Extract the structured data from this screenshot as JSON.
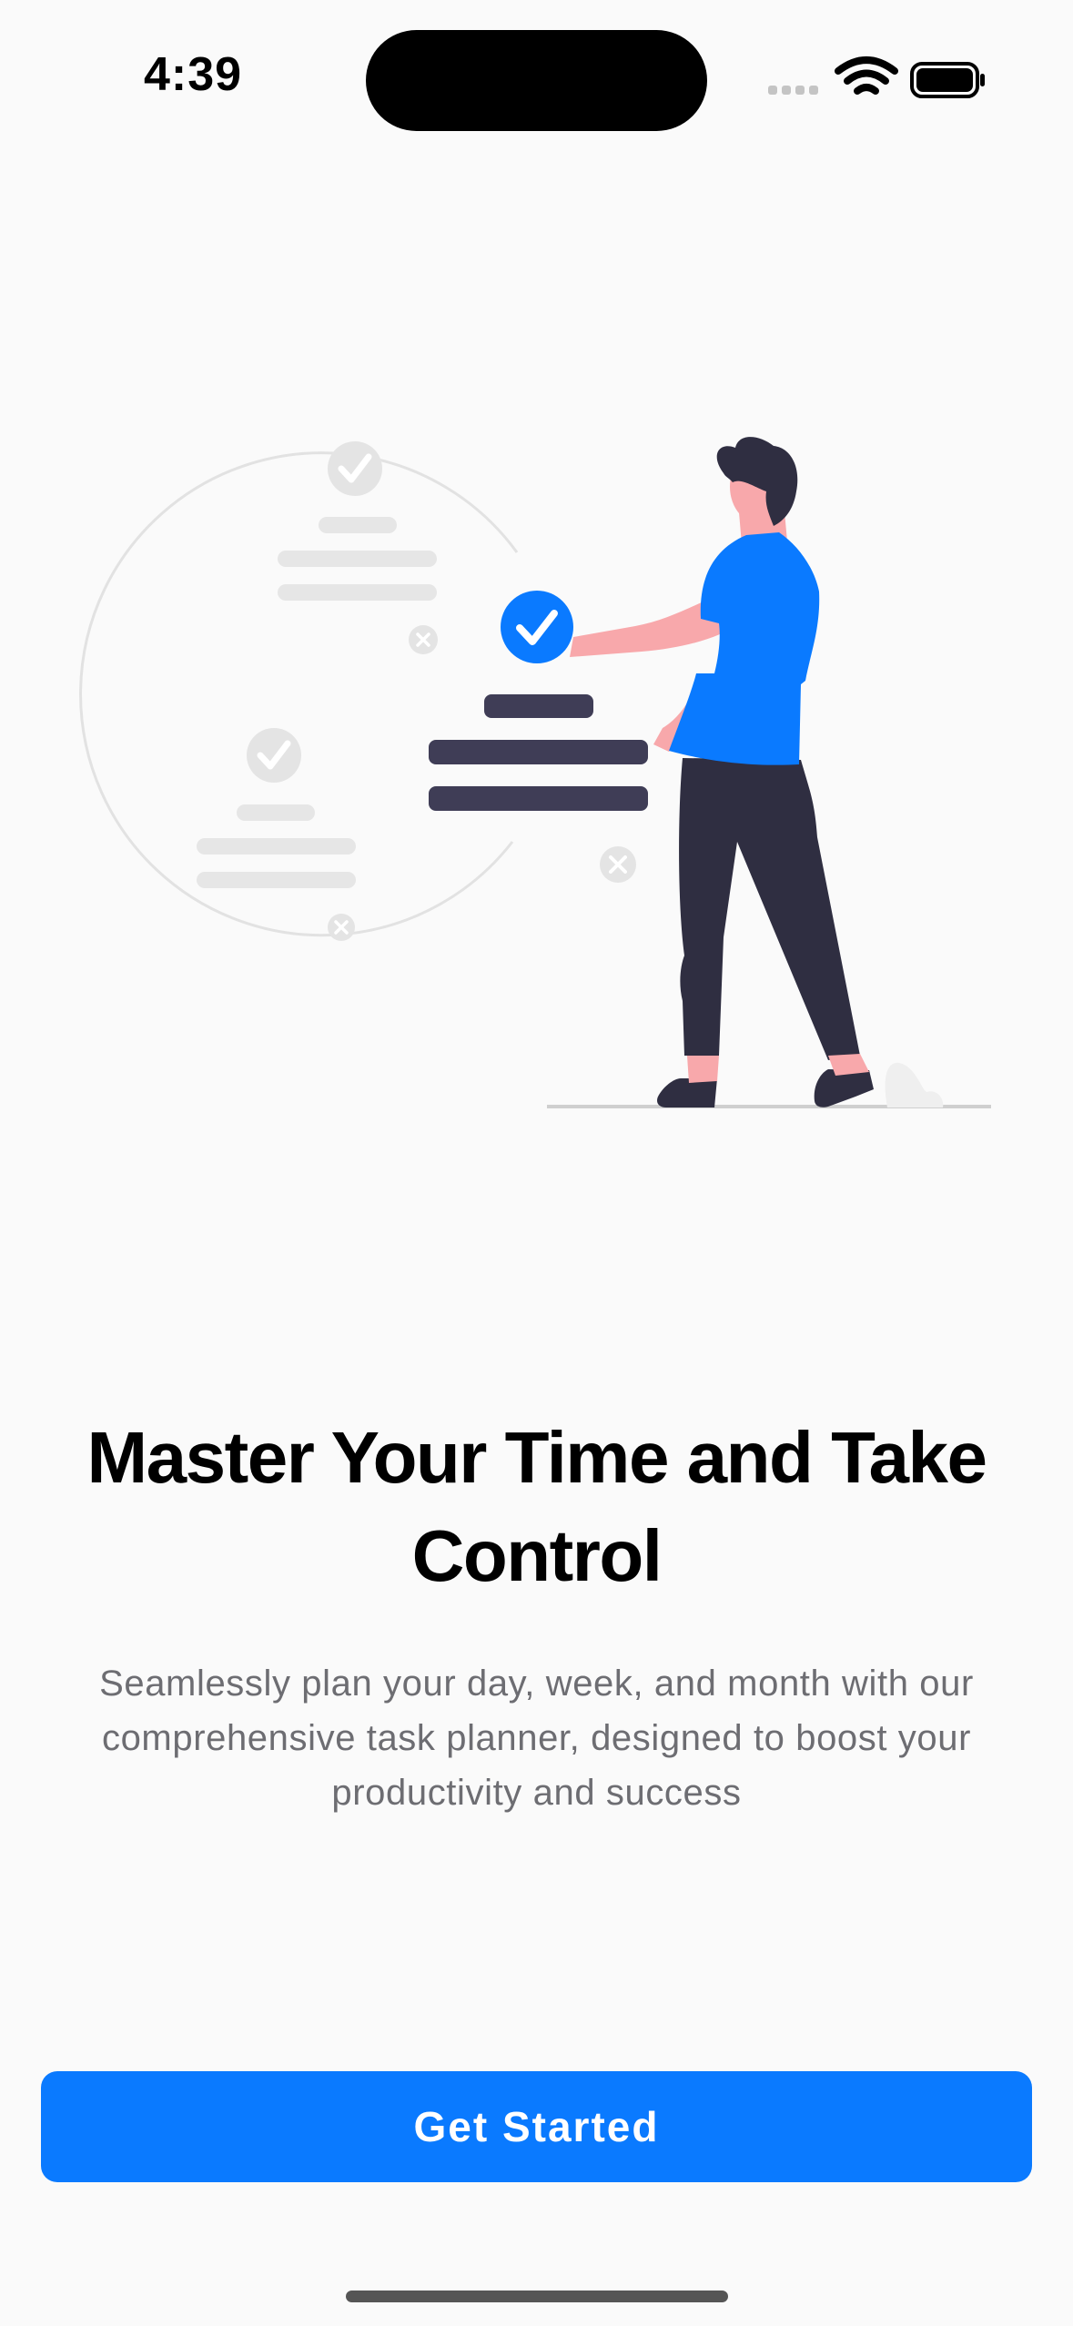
{
  "status_bar": {
    "time": "4:39",
    "icons": [
      "cellular-signal-icon",
      "wifi-icon",
      "battery-icon"
    ]
  },
  "illustration": {
    "name": "person-checking-task-list"
  },
  "onboarding": {
    "headline": "Master Your Time and Take Control",
    "description": "Seamlessly plan your day, week, and month with our comprehensive task planner, designed to boost your productivity and success",
    "cta_label": "Get Started"
  },
  "colors": {
    "accent": "#0a7aff",
    "background": "#fafafa",
    "heading": "#000000",
    "body_text": "#6d6d72",
    "illustration_dark": "#2f2e41",
    "illustration_skin": "#f8a8ab",
    "illustration_light": "#e6e6e6"
  }
}
